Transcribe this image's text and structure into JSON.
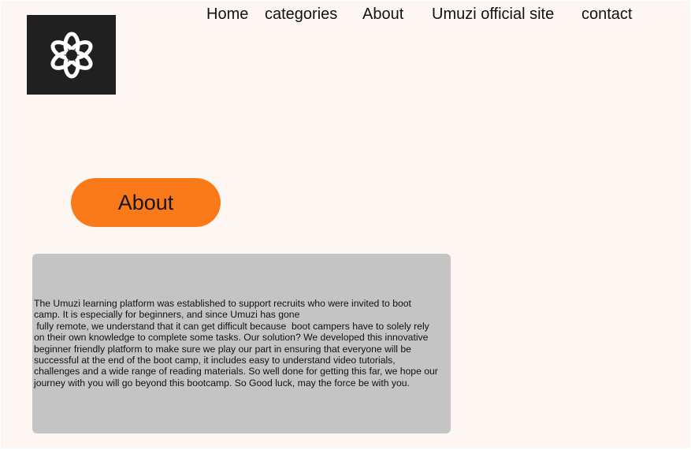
{
  "nav": {
    "items": [
      {
        "id": "home",
        "label": "Home"
      },
      {
        "id": "categories",
        "label": "categories"
      },
      {
        "id": "about",
        "label": "About"
      },
      {
        "id": "official",
        "label": "Umuzi official site"
      },
      {
        "id": "contact",
        "label": "contact"
      }
    ]
  },
  "logo": {
    "icon": "umuzi-flower-logo-icon",
    "background": "#202020"
  },
  "about_button": {
    "label": "About",
    "color": "#fa7a1a"
  },
  "about_section": {
    "background": "#c4c4c4",
    "lines": [
      "The Umuzi learning platform was established to support recruits who were invited to boot",
      "camp. It is especially for beginners, and since Umuzi has gone",
      " fully remote, we understand that it can get difficult because  boot campers have to solely rely",
      "on their own knowledge to complete some tasks. Our solution? We developed this innovative",
      "beginner friendly platform to make sure we play our part in ensuring that everyone will be",
      "successful at the end of the boot camp, it includes easy to understand video tutorials,",
      "challenges and a wide range of reading materials. So well done for getting this far, we hope our",
      "journey with you will go beyond this bootcamp. So Good luck, may the force be with you."
    ]
  },
  "colors": {
    "page_background": "#fdf6f3",
    "text": "#111111"
  }
}
